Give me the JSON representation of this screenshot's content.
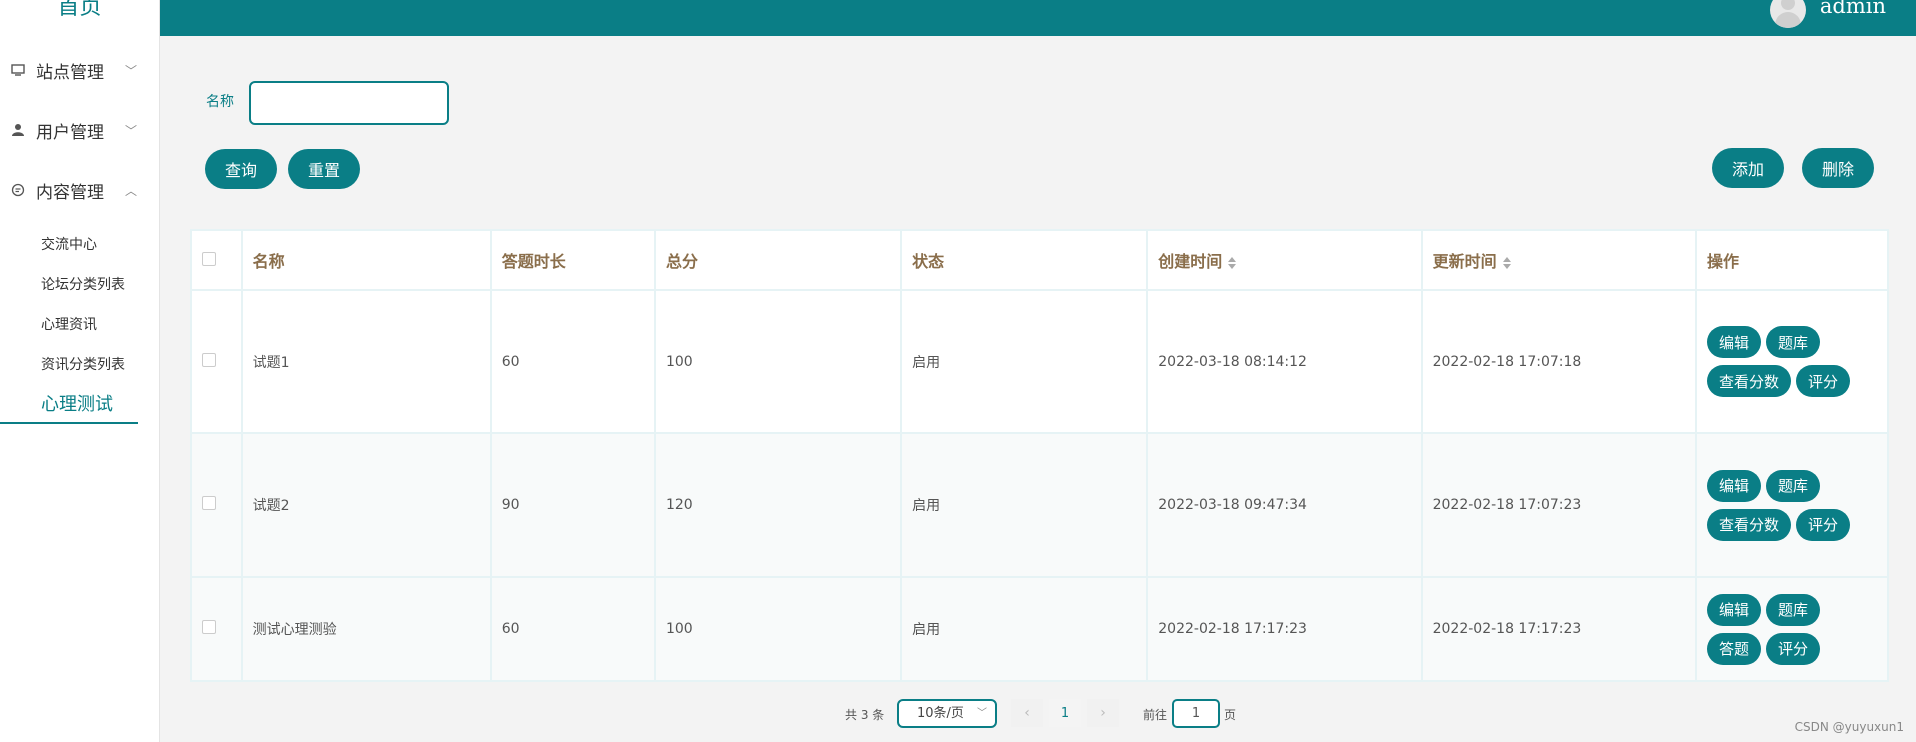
{
  "sidebar": {
    "logo": "首页",
    "groups": [
      {
        "label": "站点管理",
        "icon": "monitor-icon",
        "chevron": "﹀"
      },
      {
        "label": "用户管理",
        "icon": "user-icon",
        "chevron": "﹀"
      },
      {
        "label": "内容管理",
        "icon": "chat-icon",
        "chevron": "︿"
      }
    ],
    "items": [
      {
        "label": "交流中心"
      },
      {
        "label": "论坛分类列表"
      },
      {
        "label": "心理资讯"
      },
      {
        "label": "资讯分类列表"
      },
      {
        "label": "心理测试"
      }
    ]
  },
  "topbar": {
    "user": "admin",
    "color": "#0a7e86"
  },
  "search": {
    "label": "名称",
    "value": "",
    "query_btn": "查询",
    "reset_btn": "重置"
  },
  "actions": {
    "add": "添加",
    "delete": "删除"
  },
  "table": {
    "headers": [
      "名称",
      "答题时长",
      "总分",
      "状态",
      "创建时间",
      "更新时间",
      "操作"
    ],
    "rows": [
      {
        "name": "试题1",
        "duration": "60",
        "score": "100",
        "status": "启用",
        "created": "2022-03-18 08:14:12",
        "updated": "2022-02-18 17:07:18",
        "ops": [
          "编辑",
          "题库",
          "查看分数",
          "评分"
        ]
      },
      {
        "name": "试题2",
        "duration": "90",
        "score": "120",
        "status": "启用",
        "created": "2022-03-18 09:47:34",
        "updated": "2022-02-18 17:07:23",
        "ops": [
          "编辑",
          "题库",
          "查看分数",
          "评分"
        ]
      },
      {
        "name": "测试心理测验",
        "duration": "60",
        "score": "100",
        "status": "启用",
        "created": "2022-02-18 17:17:23",
        "updated": "2022-02-18 17:17:23",
        "ops": [
          "编辑",
          "题库",
          "答题",
          "评分"
        ]
      }
    ]
  },
  "pagination": {
    "total": "共 3 条",
    "page_size": "10条/页",
    "current": "1",
    "goto_label": "前往",
    "goto_value": "1",
    "unit": "页",
    "prev": "‹",
    "next": "›"
  },
  "watermark": "CSDN @yuyuxun1"
}
